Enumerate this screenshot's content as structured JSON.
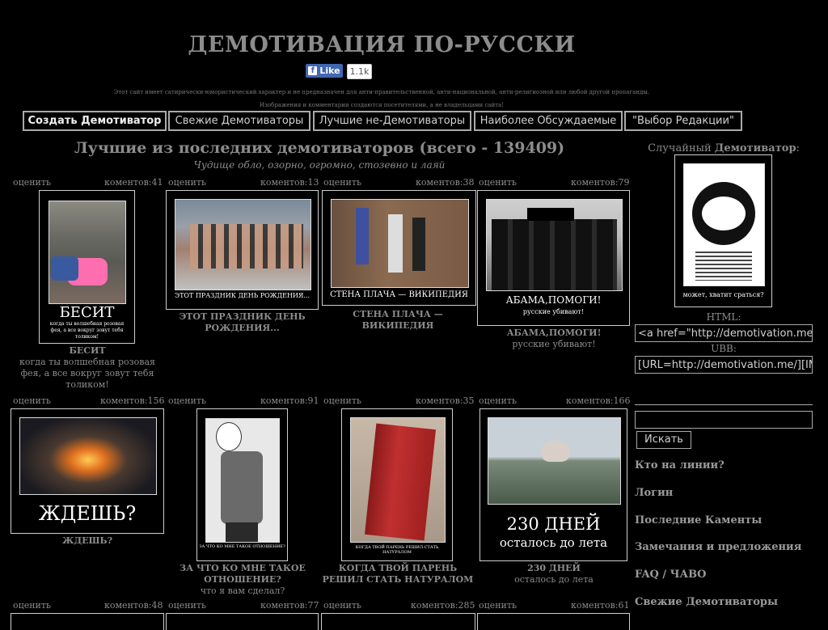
{
  "header": {
    "title": "ДЕМОТИВАЦИЯ ПО-РУССКИ",
    "fb_like": "Like",
    "fb_count": "1.1k",
    "disclaimer": "Этот сайт имеет сатирически-юмористический характер и не предназначен для анти-правительственной, анти-национальной, анти-религиозной или любой другой пропаганды.",
    "disclaimer2": "Изображения и комментарии создаются посетителями, а не владельцами сайта!"
  },
  "nav": {
    "create": "Создать Демотиватор",
    "fresh": "Свежие Демотиваторы",
    "best_non": "Лучшие не-Демотиваторы",
    "discussed": "Наиболее Обсуждаемые",
    "editors": "\"Выбор Редакции\""
  },
  "main": {
    "heading": "Лучшие из последних демотиваторов (всего - 139409)",
    "subheading": "Чудище обло, озорно, огромно, стозевно и лаяй",
    "rate_label": "оценить",
    "cards": [
      {
        "comments": "коментов:41",
        "big": "БЕСИТ",
        "small": "когда ты волшебная розовая фея, а все вокруг зовут тебя толиком!",
        "title": "БЕСИТ",
        "subtitle": "когда ты волшебная розовая фея, а все вокруг зовут тебя толиком!"
      },
      {
        "comments": "коментов:13",
        "big": "ЭТОТ ПРАЗДНИК ДЕНЬ РОЖДЕНИЯ...",
        "title": "ЭТОТ ПРАЗДНИК ДЕНЬ РОЖДЕНИЯ..."
      },
      {
        "comments": "коментов:38",
        "big": "СТЕНА ПЛАЧА — ВИКИПЕДИЯ",
        "title": "СТЕНА ПЛАЧА — ВИКИПЕДИЯ"
      },
      {
        "comments": "коментов:79",
        "big": "АБАМА,ПОМОГИ!",
        "small": "русские убивают!",
        "title": "АБАМА,ПОМОГИ!",
        "subtitle": "русские убивают!"
      },
      {
        "comments": "коментов:156",
        "big": "ЖДЕШЬ?",
        "title": "ЖДЕШЬ?"
      },
      {
        "comments": "коментов:91",
        "big": "ЗА ЧТО КО МНЕ ТАКОЕ ОТНОШЕНИЕ?",
        "small": "что я вам сделал?",
        "title": "ЗА ЧТО КО МНЕ ТАКОЕ ОТНОШЕНИЕ?",
        "subtitle": "что я вам сделал?"
      },
      {
        "comments": "коментов:35",
        "big": "КОГДА ТВОЙ ПАРЕНЬ РЕШИЛ СТАТЬ НАТУРАЛОМ",
        "title": "КОГДА ТВОЙ ПАРЕНЬ РЕШИЛ СТАТЬ НАТУРАЛОМ"
      },
      {
        "comments": "коментов:166",
        "big": "230 ДНЕЙ",
        "small": "осталось до лета",
        "title": "230 ДНЕЙ",
        "subtitle": "осталось до лета"
      },
      {
        "comments": "коментов:48"
      },
      {
        "comments": "коментов:77"
      },
      {
        "comments": "коментов:285"
      },
      {
        "comments": "коментов:61"
      }
    ]
  },
  "sidebar": {
    "random_prefix": "Случайный",
    "random_bold": "Демотиватор",
    "random_colon": ":",
    "random_caption": "может, хватит сраться?",
    "html_label": "HTML:",
    "html_code": "<a href=\"http://demotivation.me/",
    "ubb_label": "UBB:",
    "ubb_code": "[URL=http://demotivation.me/][IM",
    "search_button": "Искать",
    "links": [
      "Кто на линии?",
      "Логин",
      "Последние Каменты",
      "Замечания и предложения",
      "FAQ / ЧАВО",
      "Свежие Демотиваторы"
    ]
  },
  "colors": {
    "background": "#000000",
    "text": "#8c8c8c",
    "fb_blue": "#4267b2"
  }
}
